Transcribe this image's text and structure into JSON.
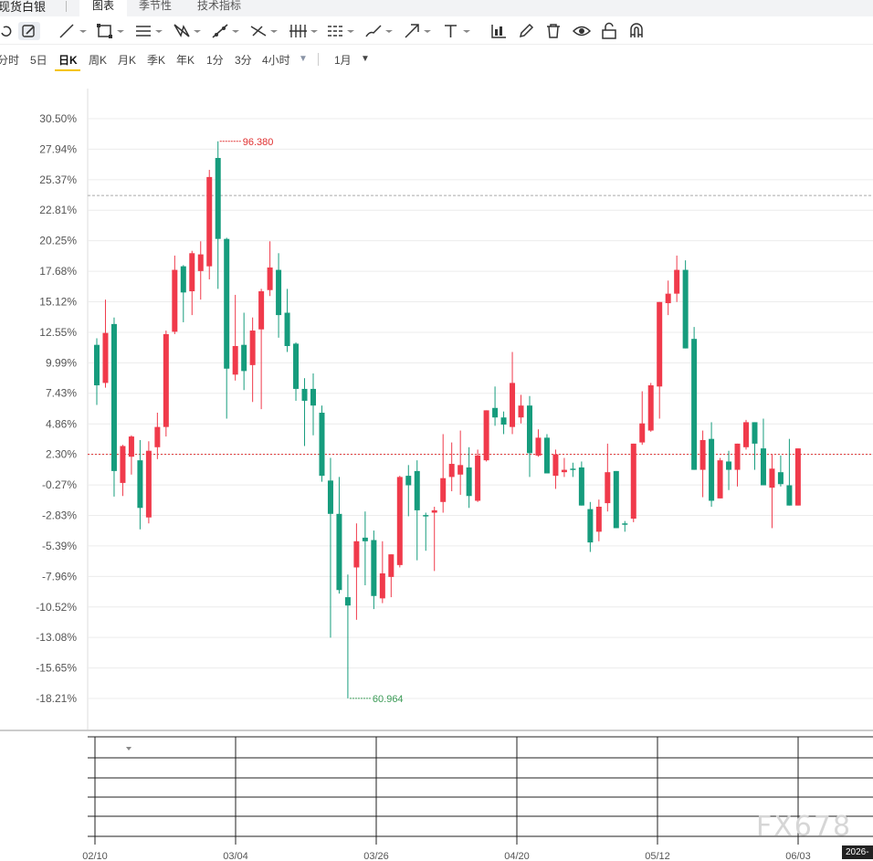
{
  "header": {
    "title": "现货白银",
    "tabs": [
      {
        "label": "图表",
        "active": true
      },
      {
        "label": "季节性",
        "active": false
      },
      {
        "label": "技术指标",
        "active": false
      }
    ]
  },
  "toolbar": {
    "tools": [
      "undo-icon",
      "pen-edit-icon",
      "line-tool-icon",
      "rectangle-tool-icon",
      "parallel-lines-icon",
      "pattern-tool-icon",
      "trend-line-icon",
      "cross-line-icon",
      "gann-tool-icon",
      "fibonacci-icon",
      "brush-icon",
      "arrow-tool-icon",
      "text-tool-icon",
      "indicator-icon",
      "pencil-icon",
      "trash-icon",
      "eye-icon",
      "unlock-icon",
      "magnet-icon"
    ]
  },
  "periods": {
    "items": [
      "分时",
      "5日",
      "日K",
      "周K",
      "月K",
      "季K",
      "年K",
      "1分",
      "3分",
      "4小时"
    ],
    "active": "日K",
    "more_icon": "triangle-down-icon",
    "range": "1月",
    "range_icon": "triangle-down-icon"
  },
  "colors": {
    "up": "#f03a4b",
    "down": "#169c7d",
    "baseline": "#e03030",
    "max_label": "#e03030",
    "min_label": "#3a9a55"
  },
  "chart_data": {
    "type": "candlestick",
    "y_axis_labels": [
      "30.50%",
      "27.94%",
      "25.37%",
      "22.81%",
      "20.25%",
      "17.68%",
      "15.12%",
      "12.55%",
      "9.99%",
      "7.43%",
      "4.86%",
      "2.30%",
      "-0.27%",
      "-2.83%",
      "-5.39%",
      "-7.96%",
      "-10.52%",
      "-13.08%",
      "-15.65%",
      "-18.21%"
    ],
    "x_axis_labels": [
      "02/10",
      "03/04",
      "03/26",
      "04/20",
      "05/12",
      "06/03"
    ],
    "max_label": "96.380",
    "min_label": "60.964",
    "baseline_pct": 2.3,
    "reference_pct": 24.05,
    "candles": [
      [
        11.5,
        12.05,
        6.45,
        8.1
      ],
      [
        8.3,
        15.3,
        7.9,
        12.5
      ],
      [
        13.25,
        13.8,
        -1.25,
        0.9
      ],
      [
        -0.1,
        3.1,
        -1.2,
        3.0
      ],
      [
        2.1,
        3.9,
        0.6,
        3.8
      ],
      [
        1.8,
        3.5,
        -4.0,
        -2.2
      ],
      [
        -3.0,
        3.4,
        -3.5,
        2.6
      ],
      [
        2.9,
        5.8,
        1.9,
        4.6
      ],
      [
        4.6,
        12.7,
        3.8,
        12.4
      ],
      [
        12.6,
        19.0,
        12.4,
        17.8
      ],
      [
        18.1,
        18.2,
        13.4,
        15.9
      ],
      [
        16.0,
        19.4,
        14.0,
        19.2
      ],
      [
        17.7,
        20.2,
        15.3,
        19.1
      ],
      [
        18.1,
        26.2,
        17.0,
        25.6
      ],
      [
        27.2,
        28.6,
        16.2,
        20.4
      ],
      [
        20.4,
        20.5,
        5.3,
        9.5
      ],
      [
        9.0,
        15.7,
        8.5,
        11.4
      ],
      [
        11.5,
        14.2,
        7.7,
        9.3
      ],
      [
        9.8,
        13.8,
        6.7,
        12.7
      ],
      [
        12.8,
        16.2,
        6.1,
        16.0
      ],
      [
        16.1,
        20.2,
        15.6,
        18.0
      ],
      [
        17.8,
        19.2,
        12.1,
        14.0
      ],
      [
        14.2,
        16.2,
        10.9,
        11.4
      ],
      [
        11.6,
        11.7,
        6.8,
        7.8
      ],
      [
        7.8,
        8.7,
        3.0,
        6.8
      ],
      [
        7.8,
        9.1,
        3.9,
        6.4
      ],
      [
        5.8,
        6.4,
        0.0,
        0.5
      ],
      [
        0.1,
        2.0,
        -13.1,
        -2.7
      ],
      [
        -2.7,
        0.4,
        -9.4,
        -9.1
      ],
      [
        -9.7,
        -7.8,
        -18.2,
        -10.4
      ],
      [
        -7.2,
        -3.5,
        -11.6,
        -5.0
      ],
      [
        -4.7,
        -2.5,
        -8.7,
        -5.0
      ],
      [
        -4.9,
        -4.1,
        -10.7,
        -9.6
      ],
      [
        -9.8,
        -5.0,
        -10.2,
        -7.7
      ],
      [
        -8.0,
        -7.1,
        -9.7,
        -6.1
      ],
      [
        -7.0,
        0.5,
        -7.2,
        0.4
      ],
      [
        0.5,
        1.4,
        -2.9,
        -0.3
      ],
      [
        0.9,
        1.8,
        -6.6,
        -2.4
      ],
      [
        -2.8,
        -2.6,
        -5.8,
        -2.9
      ],
      [
        -2.6,
        -2.1,
        -7.5,
        -2.4
      ],
      [
        -1.7,
        4.0,
        -2.6,
        0.3
      ],
      [
        0.4,
        3.3,
        -0.8,
        1.5
      ],
      [
        0.6,
        4.3,
        -1.1,
        1.4
      ],
      [
        1.2,
        2.9,
        -2.2,
        -1.2
      ],
      [
        -1.6,
        2.7,
        -1.7,
        2.2
      ],
      [
        1.8,
        5.7,
        1.7,
        6.0
      ],
      [
        6.2,
        8.0,
        4.7,
        5.4
      ],
      [
        5.4,
        5.9,
        4.0,
        4.8
      ],
      [
        4.6,
        10.9,
        4.0,
        8.3
      ],
      [
        5.4,
        7.3,
        4.9,
        6.4
      ],
      [
        6.4,
        7.2,
        0.4,
        2.4
      ],
      [
        2.2,
        4.4,
        2.1,
        3.7
      ],
      [
        3.7,
        4.0,
        0.9,
        0.7
      ],
      [
        0.5,
        2.7,
        -0.6,
        2.3
      ],
      [
        0.8,
        2.0,
        0.4,
        1.0
      ],
      [
        1.1,
        1.6,
        0.4,
        1.0
      ],
      [
        1.2,
        1.7,
        -0.9,
        -2.0
      ],
      [
        -2.3,
        -1.7,
        -5.9,
        -5.1
      ],
      [
        -4.2,
        -1.5,
        -5.0,
        -2.1
      ],
      [
        -1.8,
        3.2,
        -2.5,
        0.8
      ],
      [
        0.9,
        0.9,
        -3.8,
        -3.9
      ],
      [
        -3.5,
        -3.3,
        -4.2,
        -3.6
      ],
      [
        -3.1,
        3.2,
        -3.4,
        3.2
      ],
      [
        3.3,
        7.6,
        3.1,
        4.9
      ],
      [
        4.3,
        8.3,
        4.2,
        8.1
      ],
      [
        8.0,
        8.3,
        5.3,
        15.1
      ],
      [
        15.0,
        16.9,
        14.0,
        15.8
      ],
      [
        15.8,
        19.0,
        15.1,
        17.8
      ],
      [
        17.8,
        18.6,
        11.3,
        11.2
      ],
      [
        12.0,
        13.0,
        1.2,
        1.0
      ],
      [
        1.0,
        4.3,
        -1.3,
        3.5
      ],
      [
        3.6,
        5.0,
        -2.1,
        -1.6
      ],
      [
        -1.4,
        2.0,
        -1.2,
        1.8
      ],
      [
        1.7,
        2.6,
        -0.7,
        1.0
      ],
      [
        1.0,
        3.0,
        -0.4,
        3.2
      ],
      [
        2.9,
        5.2,
        2.7,
        5.0
      ],
      [
        5.0,
        4.7,
        1.0,
        3.2
      ],
      [
        2.8,
        5.3,
        0.0,
        -0.3
      ],
      [
        -0.5,
        2.3,
        -3.9,
        1.1
      ],
      [
        0.8,
        2.2,
        -0.4,
        -0.2
      ],
      [
        -0.3,
        3.6,
        -2.0,
        -2.0
      ],
      [
        -2.0,
        2.8,
        -0.2,
        2.8
      ]
    ]
  },
  "watermark": "FX678",
  "date_badge": "2026-"
}
